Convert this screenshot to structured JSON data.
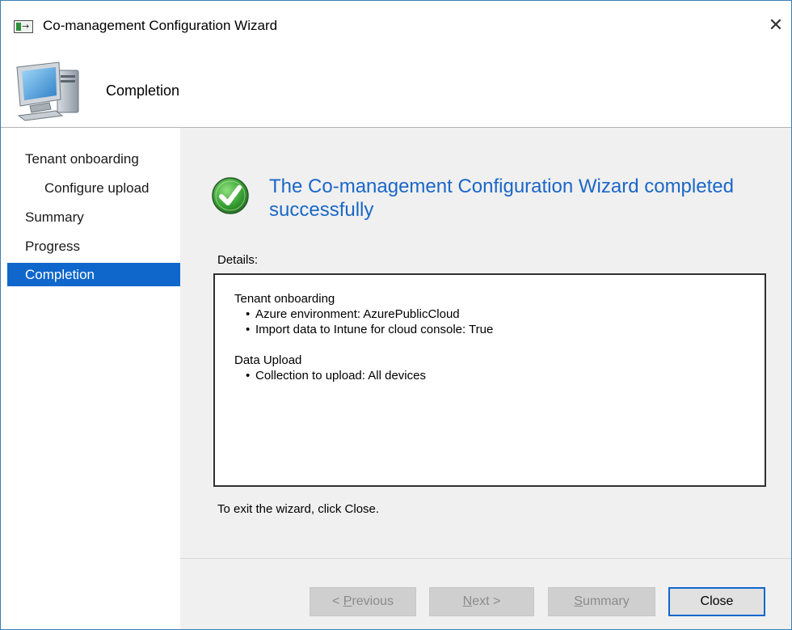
{
  "window": {
    "title": "Co-management Configuration Wizard",
    "close_label": "✕"
  },
  "header": {
    "title": "Completion"
  },
  "sidebar": {
    "items": [
      {
        "label": "Tenant onboarding",
        "level": 0,
        "active": false
      },
      {
        "label": "Configure upload",
        "level": 1,
        "active": false
      },
      {
        "label": "Summary",
        "level": 0,
        "active": false
      },
      {
        "label": "Progress",
        "level": 0,
        "active": false
      },
      {
        "label": "Completion",
        "level": 0,
        "active": true
      }
    ]
  },
  "main": {
    "heading": "The Co-management Configuration Wizard completed successfully",
    "details_label": "Details:",
    "details": {
      "groups": [
        {
          "title": "Tenant onboarding",
          "items": [
            "Azure environment: AzurePublicCloud",
            "Import data to Intune for cloud console: True"
          ]
        },
        {
          "title": "Data Upload",
          "items": [
            "Collection to upload: All devices"
          ]
        }
      ]
    },
    "exit_note": "To exit the wizard, click Close."
  },
  "buttons": {
    "previous": {
      "prefix": "< ",
      "mnemonic": "P",
      "rest": "revious",
      "enabled": false
    },
    "next": {
      "prefix": "",
      "mnemonic": "N",
      "rest": "ext >",
      "enabled": false
    },
    "summary": {
      "prefix": "",
      "mnemonic": "S",
      "rest": "ummary",
      "enabled": false
    },
    "close": {
      "label": "Close",
      "enabled": true
    }
  },
  "colors": {
    "accent": "#0f67cc",
    "heading": "#1a67c8",
    "pane_background": "#f0f0f0",
    "success_green": "#3aa335"
  },
  "icons": {
    "app": "wizard-app-icon",
    "header": "computer-icon",
    "status": "success-check-icon",
    "close": "close-icon"
  }
}
